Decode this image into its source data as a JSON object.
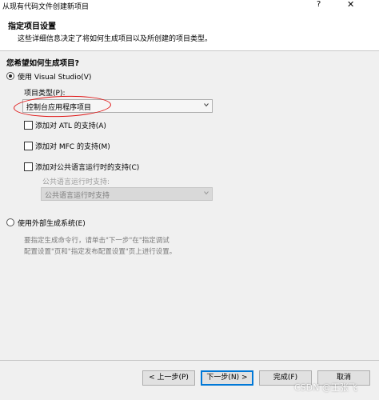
{
  "window": {
    "title": "从现有代码文件创建新项目",
    "help": "?",
    "close": "✕"
  },
  "header": {
    "title": "指定项目设置",
    "description": "这些详细信息决定了将如何生成项目以及所创建的项目类型。"
  },
  "question": "您希望如何生成项目?",
  "option_vs": {
    "label": "使用 Visual Studio(V)",
    "selected": true,
    "project_type_label": "项目类型(P):",
    "project_type_value": "控制台应用程序项目",
    "checkboxes": [
      {
        "label": "添加对 ATL 的支持(A)",
        "checked": false
      },
      {
        "label": "添加对 MFC 的支持(M)",
        "checked": false
      },
      {
        "label": "添加对公共语言运行时的支持(C)",
        "checked": false
      }
    ],
    "clr_label": "公共语言运行时支持:",
    "clr_value": "公共语言运行时支持"
  },
  "option_external": {
    "label": "使用外部生成系统(E)",
    "selected": false,
    "note_line1": "要指定生成命令行，请单击\"下一步\"在\"指定调试",
    "note_line2": "配置设置\"页和\"指定发布配置设置\"页上进行设置。"
  },
  "buttons": {
    "back": "< 上一步(P)",
    "next": "下一步(N) >",
    "finish": "完成(F)",
    "cancel": "取消"
  },
  "watermark": "CSDN @王张飞",
  "colors": {
    "annotation": "#e01818",
    "focus": "#0078d7"
  }
}
